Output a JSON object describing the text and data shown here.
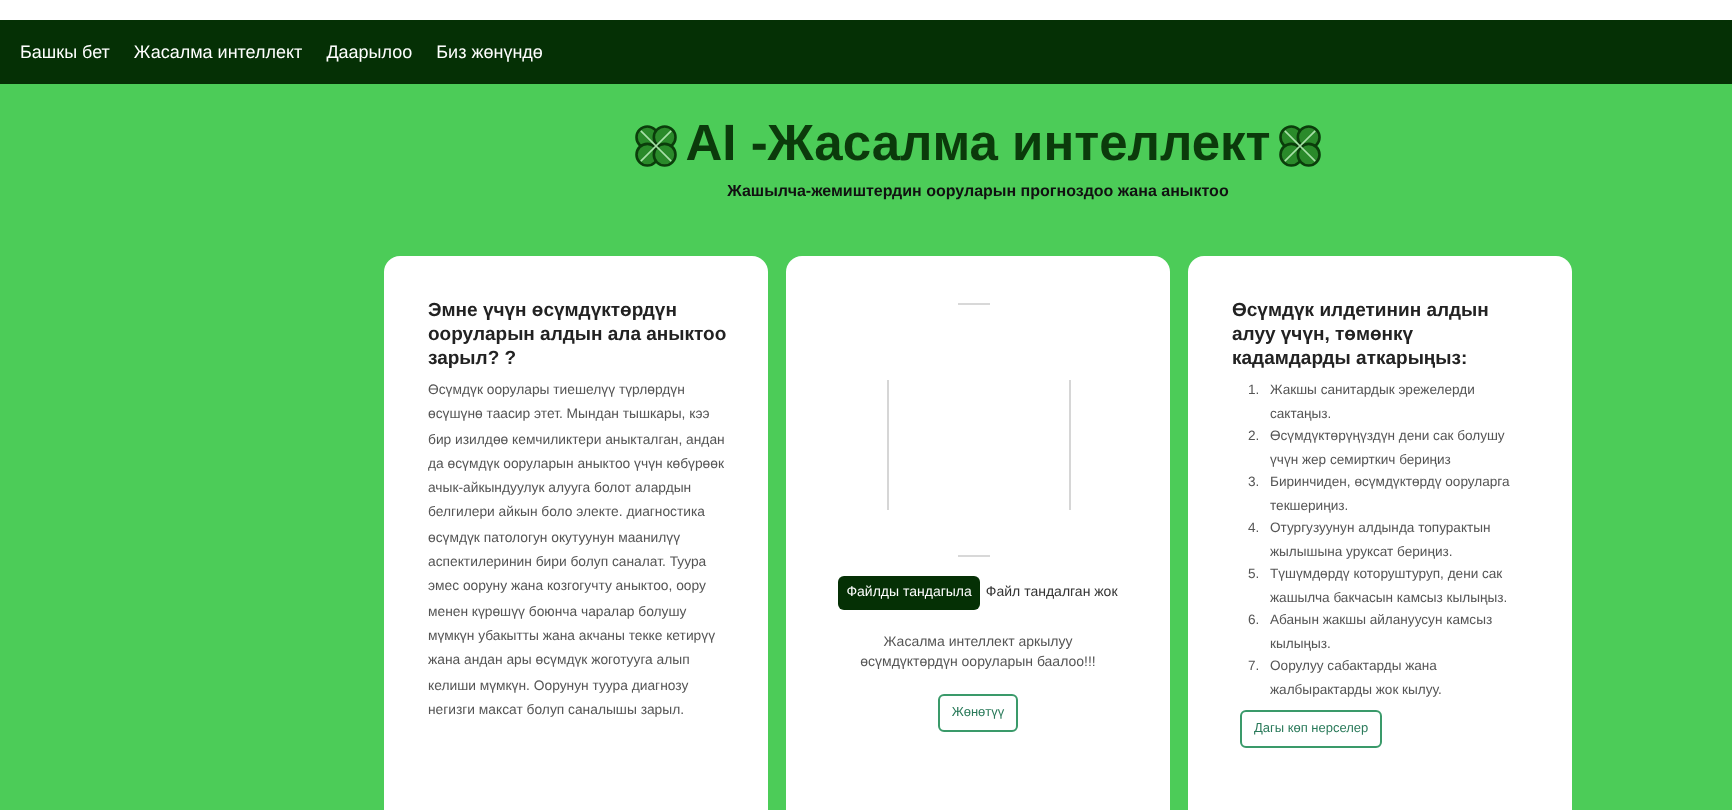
{
  "nav": {
    "items": [
      "Башкы бет",
      "Жасалма интеллект",
      "Даарылоо",
      "Биз жөнүндө"
    ]
  },
  "header": {
    "title": "AI -Жасалма интеллект",
    "subtitle": "Жашылча-жемиштердин ооруларын прогноздоо жана аныктоо"
  },
  "info_card": {
    "title": "Эмне үчүн өсүмдүктөрдүн ооруларын алдын ала аныктоо зарыл? ?",
    "text": "Өсүмдүк оорулары тиешелүү түрлөрдүн өсүшүнө таасир этет. Мындан тышкары, кээ бир изилдөө кемчиликтери аныкталган, андан да өсүмдүк ооруларын аныктоо үчүн көбүрөөк ачык-айкындуулук алууга болот алардын белгилери айкын боло электе. диагностика өсүмдүк патологун окутуунун маанилүү аспектилеринин бири болуп саналат. Туура эмес ооруну жана козгогучту аныктоо, оору менен күрөшүү боюнча чаралар болушу мүмкүн убакытты жана акчаны текке кетирүү жана андан ары өсүмдүк жоготууга алып келиши мүмкүн. Оорунун туура диагнозу негизги максат болуп саналышы зарыл."
  },
  "upload_card": {
    "file_button": "Файлды тандагыла",
    "file_status": "Файл тандалган жок",
    "caption": "Жасалма интеллект аркылуу өсүмдүктөрдүн ооруларын баалоо!!!",
    "submit": "Жөнөтүү"
  },
  "steps_card": {
    "title": "Өсүмдүк илдетинин алдын алуу үчүн, төмөнкү кадамдарды аткарыңыз:",
    "steps": [
      {
        "number": "1.",
        "text": "Жакшы санитардык эрежелерди сактаңыз."
      },
      {
        "number": "2.",
        "text": "Өсүмдүктөрүңүздүн дени сак болушу үчүн жер семирткич бериңиз"
      },
      {
        "number": "3.",
        "text": "Биринчиден, өсүмдүктөрдү ооруларга текшериңиз."
      },
      {
        "number": "4.",
        "text": "Отургузуунун алдында топурактын жылышына уруксат бериңиз."
      },
      {
        "number": "5.",
        "text": "Түшүмдөрдү которуштуруп, дени сак жашылча бакчасын камсыз кылыңыз."
      },
      {
        "number": "6.",
        "text": "Абанын жакшы айлануусун камсыз кылыңыз."
      },
      {
        "number": "7.",
        "text": "Оорулуу сабактарды жана жалбырактарды жок кылуу."
      }
    ],
    "more": "Дагы көп нерселер"
  }
}
